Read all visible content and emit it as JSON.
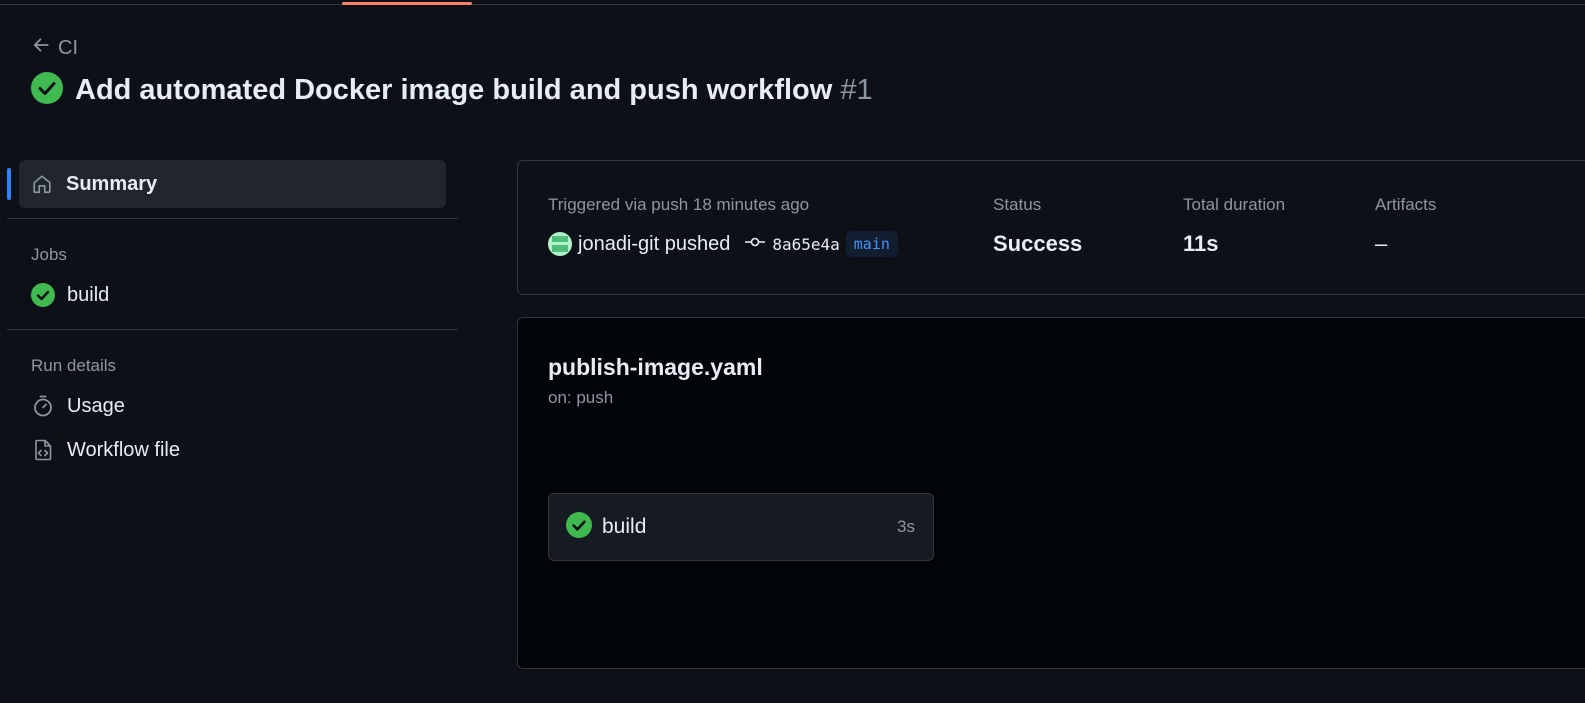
{
  "header": {
    "back_label": "CI",
    "run_title": "Add automated Docker image build and push workflow",
    "run_number": "#1"
  },
  "sidebar": {
    "summary_label": "Summary",
    "jobs_heading": "Jobs",
    "jobs": [
      {
        "label": "build",
        "status": "success"
      }
    ],
    "run_details_heading": "Run details",
    "details": [
      {
        "label": "Usage",
        "icon": "stopwatch-icon"
      },
      {
        "label": "Workflow file",
        "icon": "file-code-icon"
      }
    ]
  },
  "summary": {
    "trigger_text": "Triggered via push 18 minutes ago",
    "actor_text": "jonadi-git pushed",
    "commit_sha": "8a65e4a",
    "branch": "main",
    "status_heading": "Status",
    "status_value": "Success",
    "duration_heading": "Total duration",
    "duration_value": "11s",
    "artifacts_heading": "Artifacts",
    "artifacts_value": "–"
  },
  "workflow": {
    "file_name": "publish-image.yaml",
    "trigger": "on: push",
    "job": {
      "name": "build",
      "duration": "3s"
    }
  },
  "colors": {
    "background": "#0d1117",
    "success_green": "#3fb950",
    "accent_blue": "#2f81f7",
    "tab_underline": "#f78166"
  }
}
